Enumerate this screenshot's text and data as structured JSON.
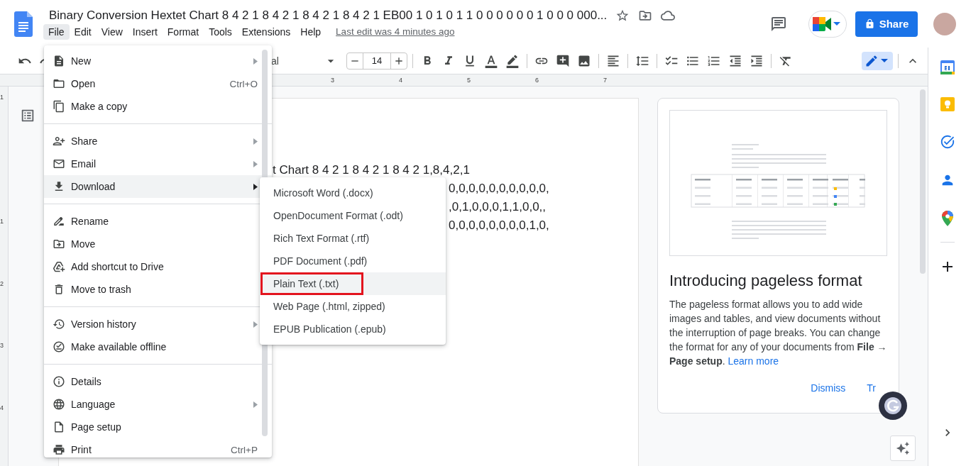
{
  "header": {
    "title": "Binary Conversion Hextet Chart 8 4 2 1 8 4 2 1 8 4 2 1 8 4 2 1 EB00 1 0 1 0 1 1 0 0 0 0 0 0 1 0 0 0 000...",
    "menus": [
      {
        "label": "File",
        "selected": true
      },
      {
        "label": "Edit",
        "selected": false
      },
      {
        "label": "View",
        "selected": false
      },
      {
        "label": "Insert",
        "selected": false
      },
      {
        "label": "Format",
        "selected": false
      },
      {
        "label": "Tools",
        "selected": false
      },
      {
        "label": "Extensions",
        "selected": false
      },
      {
        "label": "Help",
        "selected": false
      }
    ],
    "last_edit": "Last edit was 4 minutes ago",
    "share": "Share"
  },
  "toolbar": {
    "font": "al",
    "font_size": "14"
  },
  "ruler": {
    "marks": [
      "3",
      "4",
      "5",
      "6",
      "7"
    ]
  },
  "vertical_ruler": {
    "marks": [
      "1",
      "1",
      "2",
      "3",
      "4"
    ]
  },
  "page": {
    "lines": [
      "t Chart 8 4 2 1 8 4 2 1 8 4 2 1,8,4,2,1",
      "0,0,0,0,0,0,0,0,0,0,",
      ",0,1,0,0,0,1,1,0,0,,",
      "0,0,0,0,0,0,0,0,1,0,"
    ]
  },
  "file_menu": {
    "sections": [
      {
        "items": [
          {
            "label": "New",
            "submenu": true,
            "selected": false
          },
          {
            "label": "Open",
            "shortcut": "Ctrl+O",
            "submenu": false,
            "selected": false
          },
          {
            "label": "Make a copy",
            "submenu": false,
            "selected": false
          }
        ]
      },
      {
        "items": [
          {
            "label": "Share",
            "submenu": true,
            "selected": false
          },
          {
            "label": "Email",
            "submenu": true,
            "selected": false
          },
          {
            "label": "Download",
            "submenu": true,
            "selected": true
          }
        ]
      },
      {
        "items": [
          {
            "label": "Rename",
            "submenu": false,
            "selected": false
          },
          {
            "label": "Move",
            "submenu": false,
            "selected": false
          },
          {
            "label": "Add shortcut to Drive",
            "submenu": false,
            "selected": false
          },
          {
            "label": "Move to trash",
            "submenu": false,
            "selected": false
          }
        ]
      },
      {
        "items": [
          {
            "label": "Version history",
            "submenu": true,
            "selected": false
          },
          {
            "label": "Make available offline",
            "submenu": false,
            "selected": false
          }
        ]
      },
      {
        "items": [
          {
            "label": "Details",
            "submenu": false,
            "selected": false
          },
          {
            "label": "Language",
            "submenu": true,
            "selected": false
          },
          {
            "label": "Page setup",
            "submenu": false,
            "selected": false
          },
          {
            "label": "Print",
            "shortcut": "Ctrl+P",
            "submenu": false,
            "selected": false
          }
        ]
      }
    ]
  },
  "download_menu": {
    "items": [
      {
        "label": "Microsoft Word (.docx)",
        "selected": false
      },
      {
        "label": "OpenDocument Format (.odt)",
        "selected": false
      },
      {
        "label": "Rich Text Format (.rtf)",
        "selected": false
      },
      {
        "label": "PDF Document (.pdf)",
        "selected": false
      },
      {
        "label": "Plain Text (.txt)",
        "selected": true
      },
      {
        "label": "Web Page (.html, zipped)",
        "selected": false
      },
      {
        "label": "EPUB Publication (.epub)",
        "selected": false
      }
    ]
  },
  "promo": {
    "title": "Introducing pageless format",
    "body": "The pageless format allows you to add wide images and tables, and view documents without the interruption of page breaks. You can change the format for any of your documents from **File → Page setup**.",
    "link": "Learn more",
    "buttons": [
      "Dismiss",
      "Tr"
    ]
  }
}
